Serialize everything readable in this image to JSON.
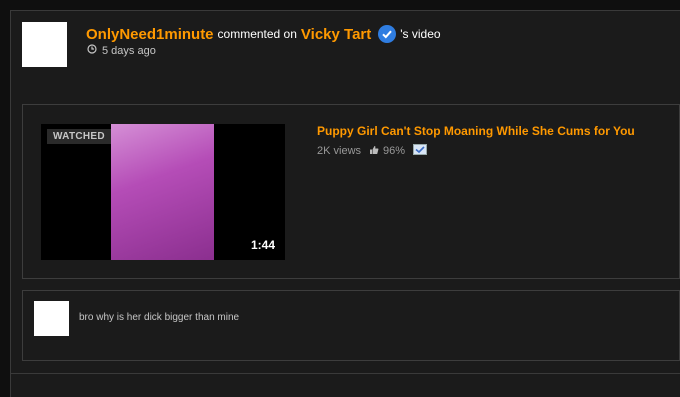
{
  "activity": {
    "username": "OnlyNeed1minute",
    "action_text": "commented on",
    "channel_name": "Vicky Tart",
    "suffix": "'s video",
    "time_ago": "5 days ago"
  },
  "video": {
    "watched_label": "WATCHED",
    "duration": "1:44",
    "title": "Puppy Girl Can't Stop Moaning While She Cums for You",
    "views": "2K views",
    "rating": "96%"
  },
  "comment": {
    "text": "bro why is her dick bigger than mine"
  },
  "colors": {
    "accent": "#ff9900",
    "verified": "#2f7de1",
    "background": "#1b1b1b"
  },
  "icons": [
    "verified-icon",
    "clock-icon",
    "thumbs-up-icon",
    "checkmark-icon"
  ]
}
